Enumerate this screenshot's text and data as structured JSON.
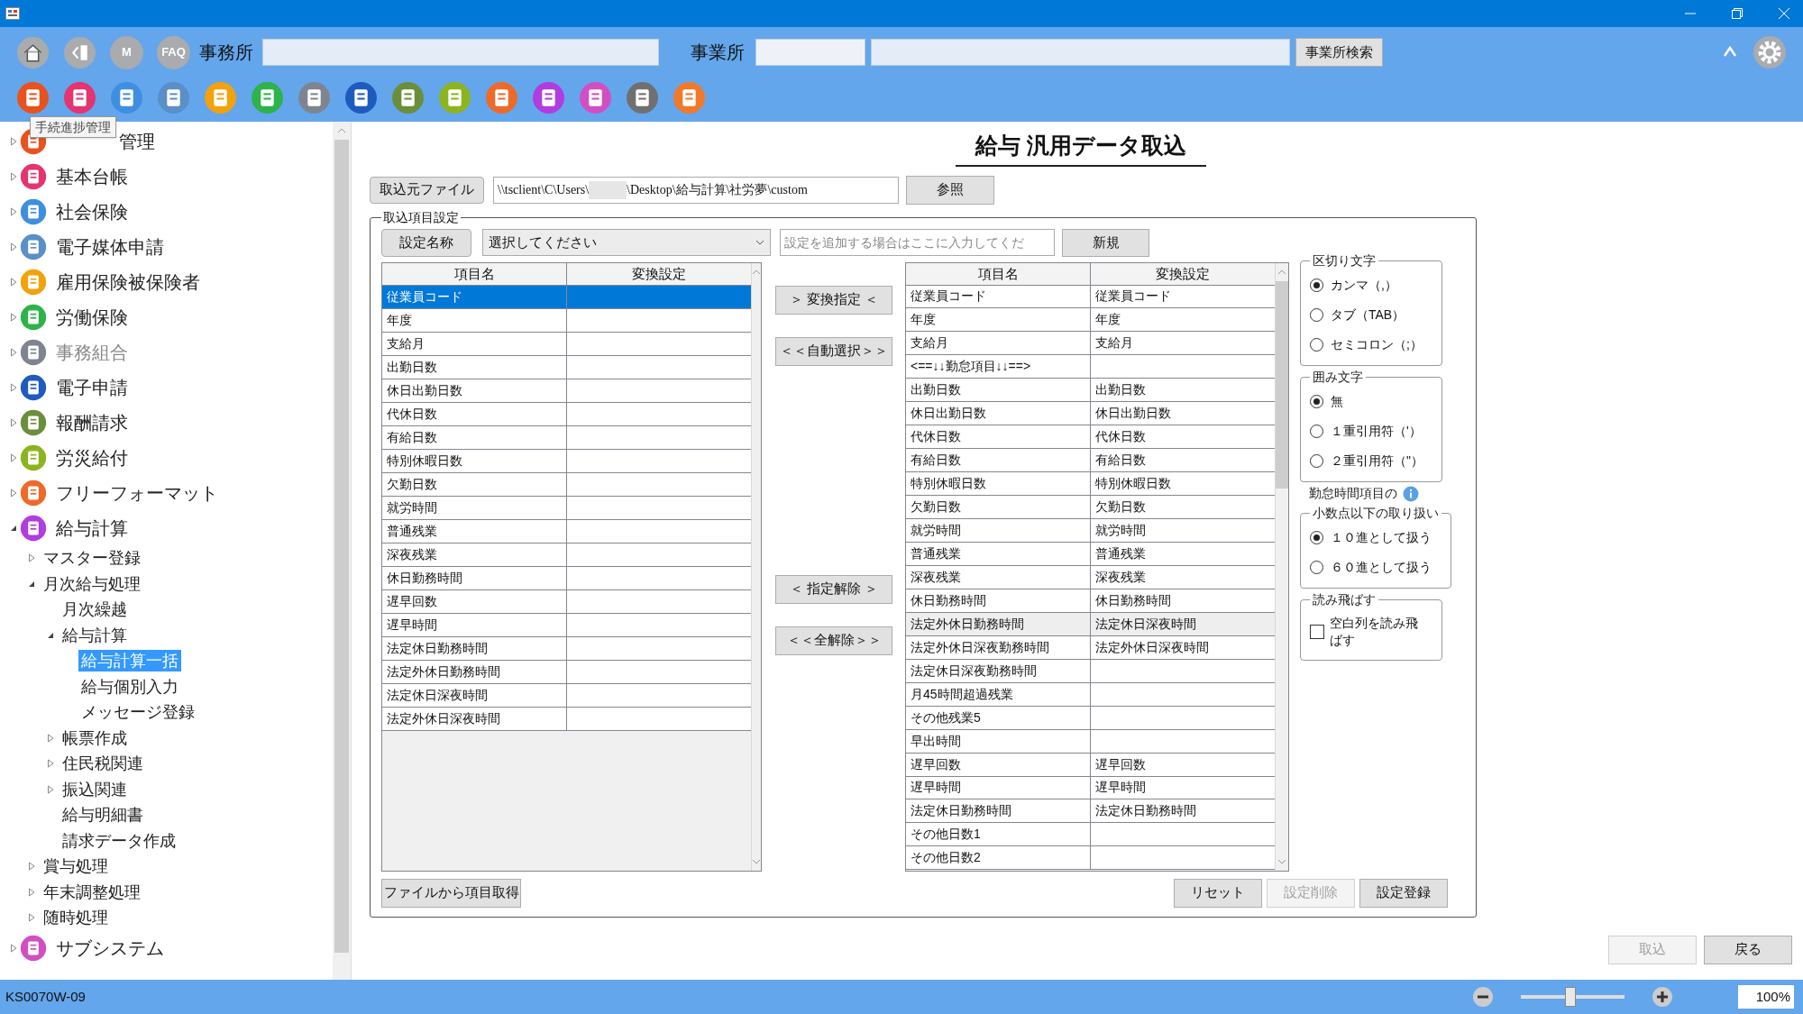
{
  "header": {
    "nav_buttons": [
      {
        "kind": "home"
      },
      {
        "kind": "back"
      },
      {
        "kind": "text",
        "label": "M"
      },
      {
        "kind": "text",
        "label": "FAQ"
      }
    ],
    "office_label": "事務所",
    "site_label": "事業所",
    "site_search": "事業所検索",
    "apps": [
      {
        "color": "#e8521c"
      },
      {
        "color": "#e5346f"
      },
      {
        "color": "#3f8fe0"
      },
      {
        "color": "#5a8fc7"
      },
      {
        "color": "#f2a20c"
      },
      {
        "color": "#2db34a"
      },
      {
        "color": "#7f8590"
      },
      {
        "color": "#1f5bbf"
      },
      {
        "color": "#6b8e3a"
      },
      {
        "color": "#8cb41e"
      },
      {
        "color": "#ee6a2a"
      },
      {
        "color": "#b13ce0"
      },
      {
        "color": "#d14fc3"
      },
      {
        "color": "#707070"
      },
      {
        "color": "#f07a2a"
      }
    ]
  },
  "tooltip": "手続進捗管理",
  "sidebar": [
    {
      "label": "管理",
      "color": "#e8521c",
      "kind": "folder",
      "expanded": false,
      "disabled": false
    },
    {
      "label": "基本台帳",
      "color": "#e5346f",
      "kind": "folder",
      "expanded": false,
      "disabled": false
    },
    {
      "label": "社会保険",
      "color": "#3f8fe0",
      "kind": "folder",
      "expanded": false,
      "disabled": false
    },
    {
      "label": "電子媒体申請",
      "color": "#5a8fc7",
      "kind": "folder",
      "expanded": false,
      "disabled": false
    },
    {
      "label": "雇用保険被保険者",
      "color": "#f2a20c",
      "kind": "folder",
      "expanded": false,
      "disabled": false
    },
    {
      "label": "労働保険",
      "color": "#2db34a",
      "kind": "folder",
      "expanded": false,
      "disabled": false
    },
    {
      "label": "事務組合",
      "color": "#7f8590",
      "kind": "folder",
      "expanded": false,
      "disabled": true
    },
    {
      "label": "電子申請",
      "color": "#1f5bbf",
      "kind": "folder",
      "expanded": false,
      "disabled": false
    },
    {
      "label": "報酬請求",
      "color": "#6b8e3a",
      "kind": "folder",
      "expanded": false,
      "disabled": false
    },
    {
      "label": "労災給付",
      "color": "#8cb41e",
      "kind": "folder",
      "expanded": false,
      "disabled": false
    },
    {
      "label": "フリーフォーマット",
      "color": "#ee6a2a",
      "kind": "folder",
      "expanded": false,
      "disabled": false
    },
    {
      "label": "給与計算",
      "color": "#b13ce0",
      "kind": "folder",
      "expanded": true,
      "disabled": false,
      "children": [
        {
          "label": "マスター登録",
          "kind": "folder",
          "expanded": false,
          "selected": false
        },
        {
          "label": "月次給与処理",
          "kind": "folder",
          "expanded": true,
          "selected": false,
          "children": [
            {
              "label": "月次繰越",
              "kind": "leaf",
              "selected": false
            },
            {
              "label": "給与計算",
              "kind": "folder",
              "expanded": true,
              "selected": false,
              "children": [
                {
                  "label": "給与計算一括",
                  "kind": "leaf",
                  "selected": true
                },
                {
                  "label": "給与個別入力",
                  "kind": "leaf",
                  "selected": false
                },
                {
                  "label": "メッセージ登録",
                  "kind": "leaf",
                  "selected": false
                }
              ]
            },
            {
              "label": "帳票作成",
              "kind": "folder",
              "expanded": false,
              "selected": false
            },
            {
              "label": "住民税関連",
              "kind": "folder",
              "expanded": false,
              "selected": false
            },
            {
              "label": "振込関連",
              "kind": "folder",
              "expanded": false,
              "selected": false
            },
            {
              "label": "給与明細書",
              "kind": "leaf",
              "selected": false
            },
            {
              "label": "請求データ作成",
              "kind": "leaf",
              "selected": false
            }
          ]
        },
        {
          "label": "賞与処理",
          "kind": "folder",
          "expanded": false,
          "selected": false
        },
        {
          "label": "年末調整処理",
          "kind": "folder",
          "expanded": false,
          "selected": false
        },
        {
          "label": "随時処理",
          "kind": "folder",
          "expanded": false,
          "selected": false
        }
      ]
    },
    {
      "label": "サブシステム",
      "color": "#d14fc3",
      "kind": "folder",
      "expanded": false,
      "disabled": false
    }
  ],
  "page_title": "給与 汎用データ取込",
  "source_file": {
    "button": "取込元ファイル",
    "path_start": "\\\\tsclient\\C\\Users\\",
    "path_end": "\\Desktop\\給与計算\\社労夢\\custom",
    "browse": "参照"
  },
  "settings_group": {
    "legend": "取込項目設定",
    "name_button": "設定名称",
    "select_value": "選択してください",
    "new_name_placeholder": "設定を追加する場合はここに入力してくだ",
    "new_button": "新規"
  },
  "source_table": {
    "columns": [
      "項目名",
      "変換設定"
    ],
    "rows": [
      {
        "cells": [
          "従業員コード",
          ""
        ],
        "selected": true
      },
      {
        "cells": [
          "年度",
          ""
        ],
        "selected": false
      },
      {
        "cells": [
          "支給月",
          ""
        ],
        "selected": false
      },
      {
        "cells": [
          "出勤日数",
          ""
        ],
        "selected": false
      },
      {
        "cells": [
          "休日出勤日数",
          ""
        ],
        "selected": false
      },
      {
        "cells": [
          "代休日数",
          ""
        ],
        "selected": false
      },
      {
        "cells": [
          "有給日数",
          ""
        ],
        "selected": false
      },
      {
        "cells": [
          "特別休暇日数",
          ""
        ],
        "selected": false
      },
      {
        "cells": [
          "欠勤日数",
          ""
        ],
        "selected": false
      },
      {
        "cells": [
          "就労時間",
          ""
        ],
        "selected": false
      },
      {
        "cells": [
          "普通残業",
          ""
        ],
        "selected": false
      },
      {
        "cells": [
          "深夜残業",
          ""
        ],
        "selected": false
      },
      {
        "cells": [
          "休日勤務時間",
          ""
        ],
        "selected": false
      },
      {
        "cells": [
          "遅早回数",
          ""
        ],
        "selected": false
      },
      {
        "cells": [
          "遅早時間",
          ""
        ],
        "selected": false
      },
      {
        "cells": [
          "法定休日勤務時間",
          ""
        ],
        "selected": false
      },
      {
        "cells": [
          "法定外休日勤務時間",
          ""
        ],
        "selected": false
      },
      {
        "cells": [
          "法定休日深夜時間",
          ""
        ],
        "selected": false
      },
      {
        "cells": [
          "法定外休日深夜時間",
          ""
        ],
        "selected": false
      }
    ]
  },
  "transfer_buttons": [
    "＞ 変換指定 ＜",
    "＜＜自動選択＞＞",
    "＜ 指定解除 ＞",
    "＜＜全解除＞＞"
  ],
  "target_table": {
    "columns": [
      "項目名",
      "変換設定"
    ],
    "rows": [
      {
        "cells": [
          "従業員コード",
          "従業員コード"
        ],
        "selected": false
      },
      {
        "cells": [
          "年度",
          "年度"
        ],
        "selected": false
      },
      {
        "cells": [
          "支給月",
          "支給月"
        ],
        "selected": false
      },
      {
        "cells": [
          "<==↓↓勤怠項目↓↓==>",
          ""
        ],
        "selected": false
      },
      {
        "cells": [
          "出勤日数",
          "出勤日数"
        ],
        "selected": false
      },
      {
        "cells": [
          "休日出勤日数",
          "休日出勤日数"
        ],
        "selected": false
      },
      {
        "cells": [
          "代休日数",
          "代休日数"
        ],
        "selected": false
      },
      {
        "cells": [
          "有給日数",
          "有給日数"
        ],
        "selected": false
      },
      {
        "cells": [
          "特別休暇日数",
          "特別休暇日数"
        ],
        "selected": false
      },
      {
        "cells": [
          "欠勤日数",
          "欠勤日数"
        ],
        "selected": false
      },
      {
        "cells": [
          "就労時間",
          "就労時間"
        ],
        "selected": false
      },
      {
        "cells": [
          "普通残業",
          "普通残業"
        ],
        "selected": false
      },
      {
        "cells": [
          "深夜残業",
          "深夜残業"
        ],
        "selected": false
      },
      {
        "cells": [
          "休日勤務時間",
          "休日勤務時間"
        ],
        "selected": false
      },
      {
        "cells": [
          "法定外休日勤務時間",
          "法定休日深夜時間"
        ],
        "selected": true
      },
      {
        "cells": [
          "法定外休日深夜勤務時間",
          "法定外休日深夜時間"
        ],
        "selected": false
      },
      {
        "cells": [
          "法定休日深夜勤務時間",
          ""
        ],
        "selected": false
      },
      {
        "cells": [
          "月45時間超過残業",
          ""
        ],
        "selected": false
      },
      {
        "cells": [
          "その他残業5",
          ""
        ],
        "selected": false
      },
      {
        "cells": [
          "早出時間",
          ""
        ],
        "selected": false
      },
      {
        "cells": [
          "遅早回数",
          "遅早回数"
        ],
        "selected": false
      },
      {
        "cells": [
          "遅早時間",
          "遅早時間"
        ],
        "selected": false
      },
      {
        "cells": [
          "法定休日勤務時間",
          "法定休日勤務時間"
        ],
        "selected": false
      },
      {
        "cells": [
          "その他日数1",
          ""
        ],
        "selected": false
      },
      {
        "cells": [
          "その他日数2",
          ""
        ],
        "selected": false
      }
    ]
  },
  "options": [
    {
      "title": "区切り文字",
      "kind": "radio",
      "items": [
        {
          "label": "カンマ（,）",
          "selected": true
        },
        {
          "label": "タブ（TAB）",
          "selected": false
        },
        {
          "label": "セミコロン（;）",
          "selected": false
        }
      ]
    },
    {
      "title": "囲み文字",
      "kind": "radio",
      "items": [
        {
          "label": "無",
          "selected": true
        },
        {
          "label": "１重引用符（'）",
          "selected": false
        },
        {
          "label": "２重引用符（\"）",
          "selected": false
        }
      ]
    },
    {
      "caption": "勤怠時間項目の",
      "title": "小数点以下の取り扱い",
      "kind": "radio",
      "items": [
        {
          "label": "１０進として扱う",
          "selected": true
        },
        {
          "label": "６０進として扱う",
          "selected": false
        }
      ]
    },
    {
      "title": "読み飛ばす",
      "kind": "checkbox",
      "items": [
        {
          "label": "空白列を読み飛ばす",
          "checked": false
        }
      ]
    }
  ],
  "left_bottom_button": "ファイルから項目取得",
  "settings_buttons": [
    {
      "label": "リセット",
      "disabled": false
    },
    {
      "label": "設定削除",
      "disabled": true
    },
    {
      "label": "設定登録",
      "disabled": false
    }
  ],
  "footer_buttons": [
    {
      "label": "取込",
      "disabled": true
    },
    {
      "label": "戻る",
      "disabled": false
    }
  ],
  "status_bar": {
    "screen_id": "KS0070W-09",
    "zoom": {
      "level": 0.48,
      "value": "100%"
    }
  }
}
